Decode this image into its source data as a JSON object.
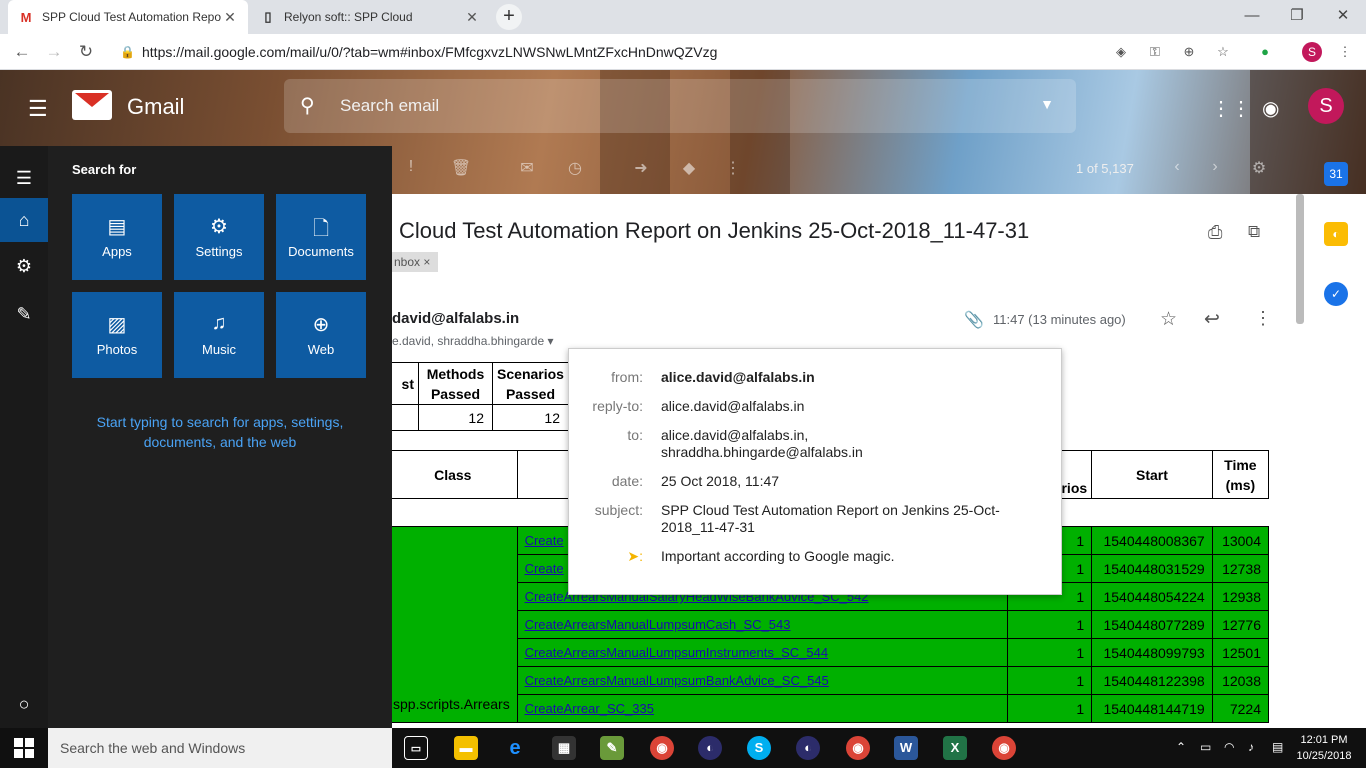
{
  "browser": {
    "tabs": [
      {
        "title": "SPP Cloud Test Automation Repo",
        "favicon": "M"
      },
      {
        "title": "Relyon soft:: SPP Cloud",
        "favicon": "page-icon"
      }
    ],
    "url": "https://mail.google.com/mail/u/0/?tab=wm#inbox/FMfcgxvzLNWSNwLMntZFxcHnDnwQZVzg",
    "profile_initial": "S"
  },
  "gmail": {
    "logo_text": "Gmail",
    "search_placeholder": "Search email",
    "avatar_initial": "S",
    "paging": "1 of 5,137",
    "subject": "Cloud Test Automation Report on Jenkins 25-Oct-2018_11-47-31",
    "label_chip": "nbox ×",
    "sender": "david@alfalabs.in",
    "to_line": "e.david, shraddha.bhingarde ▾",
    "time": "11:47 (13 minutes ago)"
  },
  "summary_table": {
    "headers": [
      "st",
      "Methods\nPassed",
      "Scenarios\nPassed"
    ],
    "row": [
      "",
      "12",
      "12"
    ]
  },
  "detail_table": {
    "headers": {
      "class": "Class",
      "scenarios": "rios",
      "start": "Start",
      "time": "Time\n(ms)"
    },
    "class_name": "spp.scripts.Arrears",
    "rows": [
      {
        "method": "Create",
        "scenarios": "1",
        "start": "1540448008367",
        "time": "13004"
      },
      {
        "method": "Create",
        "scenarios": "1",
        "start": "1540448031529",
        "time": "12738"
      },
      {
        "method": "CreateArrearsManualSalaryHeadWiseBankAdvice_SC_542",
        "scenarios": "1",
        "start": "1540448054224",
        "time": "12938"
      },
      {
        "method": "CreateArrearsManualLumpsumCash_SC_543",
        "scenarios": "1",
        "start": "1540448077289",
        "time": "12776"
      },
      {
        "method": "CreateArrearsManualLumpsumInstruments_SC_544",
        "scenarios": "1",
        "start": "1540448099793",
        "time": "12501"
      },
      {
        "method": "CreateArrearsManualLumpsumBankAdvice_SC_545",
        "scenarios": "1",
        "start": "1540448122398",
        "time": "12038"
      },
      {
        "method": "CreateArrear_SC_335",
        "scenarios": "1",
        "start": "1540448144719",
        "time": "7224"
      }
    ]
  },
  "popup": {
    "from_label": "from:",
    "from": "alice.david@alfalabs.in",
    "replyto_label": "reply-to:",
    "replyto": "alice.david@alfalabs.in",
    "to_label": "to:",
    "to": "alice.david@alfalabs.in,",
    "to2": "shraddha.bhingarde@alfalabs.in",
    "date_label": "date:",
    "date": "25 Oct 2018, 11:47",
    "subject_label": "subject:",
    "subject": "SPP Cloud Test Automation Report on Jenkins 25-Oct-2018_11-47-31",
    "importance": "Important according to Google magic."
  },
  "start_menu": {
    "search_for": "Search for",
    "tiles": [
      {
        "label": "Apps",
        "icon": "apps-icon"
      },
      {
        "label": "Settings",
        "icon": "gear-icon"
      },
      {
        "label": "Documents",
        "icon": "document-icon"
      },
      {
        "label": "Photos",
        "icon": "photo-icon"
      },
      {
        "label": "Music",
        "icon": "music-icon"
      },
      {
        "label": "Web",
        "icon": "globe-icon"
      }
    ],
    "hint": "Start typing to search for apps, settings, documents, and the web"
  },
  "taskbar": {
    "search_placeholder": "Search the web and Windows",
    "time": "12:01 PM",
    "date": "10/25/2018"
  }
}
